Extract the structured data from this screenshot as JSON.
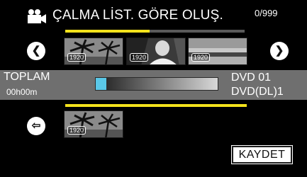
{
  "header": {
    "icon": "movie-camera-icon",
    "title": "ÇALMA LİST. GÖRE OLUŞ.",
    "counter": "0/999"
  },
  "scrollbar": {
    "position_fraction": 0.47
  },
  "upper_row": {
    "prev_icon": "left-arrow-circle-icon",
    "next_icon": "right-arrow-circle-icon",
    "prev_glyph": "❮",
    "next_glyph": "❯",
    "thumbnails": [
      {
        "badge": "1920"
      },
      {
        "badge": "1920"
      },
      {
        "badge": "1920"
      }
    ]
  },
  "info": {
    "total_label": "TOPLAM",
    "total_time": "00h00m",
    "capacity_fraction": 0.09,
    "disc_line1": "DVD   01",
    "disc_line2": "DVD(DL)1"
  },
  "lower_row": {
    "back_icon": "return-arrow-circle-icon",
    "back_glyph": "⇦",
    "thumbnails": [
      {
        "badge": "1920"
      }
    ]
  },
  "footer": {
    "save_label": "KAYDET"
  },
  "colors": {
    "accent_yellow": "#f3e21c",
    "capacity_blue": "#5ac8e8",
    "band_gray": "#6f6f6f"
  }
}
